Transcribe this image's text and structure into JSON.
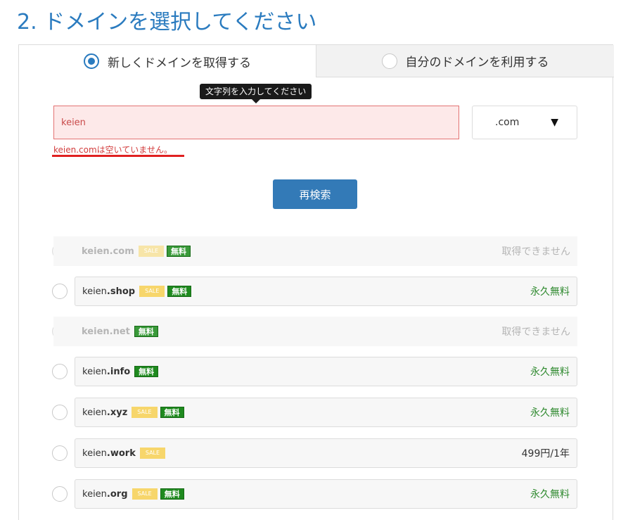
{
  "page_title": "2. ドメインを選択してください",
  "tabs": {
    "new_domain": "新しくドメインを取得する",
    "own_domain": "自分のドメインを利用する"
  },
  "tooltip": "文字列を入力してください",
  "search": {
    "value": "keien",
    "tld": ".com",
    "tld_arrow": "▼"
  },
  "error_message": "keien.comは空いていません。",
  "research_button": "再検索",
  "badges": {
    "sale": "SALE",
    "free": "無料"
  },
  "results": [
    {
      "name": "keien",
      "tld": ".com",
      "sale": true,
      "free": true,
      "status": "取得できません",
      "available": false
    },
    {
      "name": "keien",
      "tld": ".shop",
      "sale": true,
      "free": true,
      "status": "永久無料",
      "available": true
    },
    {
      "name": "keien",
      "tld": ".net",
      "sale": false,
      "free": true,
      "status": "取得できません",
      "available": false
    },
    {
      "name": "keien",
      "tld": ".info",
      "sale": false,
      "free": true,
      "status": "永久無料",
      "available": true
    },
    {
      "name": "keien",
      "tld": ".xyz",
      "sale": true,
      "free": true,
      "status": "永久無料",
      "available": true
    },
    {
      "name": "keien",
      "tld": ".work",
      "sale": true,
      "free": false,
      "status": "499円/1年",
      "available": true
    },
    {
      "name": "keien",
      "tld": ".org",
      "sale": true,
      "free": true,
      "status": "永久無料",
      "available": true
    }
  ],
  "colors": {
    "accent": "#2a7bbf",
    "button": "#337ab7",
    "error": "#d23c3c",
    "free_badge": "#1f8a1f",
    "sale_badge": "#f7d66b"
  }
}
